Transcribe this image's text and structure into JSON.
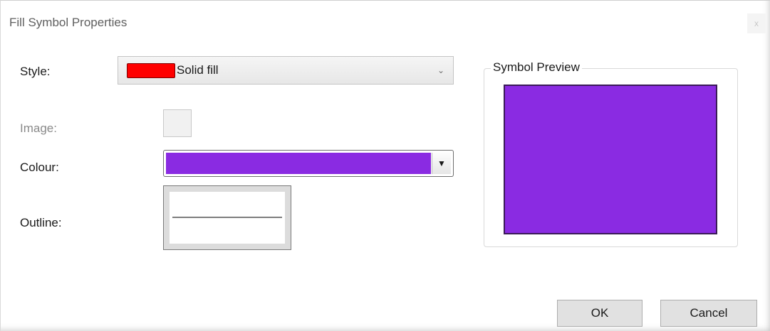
{
  "window": {
    "title": "Fill Symbol Properties",
    "close_label": "x"
  },
  "form": {
    "style_label": "Style:",
    "style_value": "Solid fill",
    "style_swatch_color": "#ff0000",
    "image_label": "Image:",
    "colour_label": "Colour:",
    "colour_value_color": "#8a2be2",
    "outline_label": "Outline:"
  },
  "preview": {
    "legend": "Symbol Preview",
    "fill_color": "#8a2be2"
  },
  "buttons": {
    "ok_label": "OK",
    "cancel_label": "Cancel"
  },
  "icons": {
    "style_dropdown": "chevron-down-icon",
    "colour_dropdown": "triangle-down-icon"
  }
}
